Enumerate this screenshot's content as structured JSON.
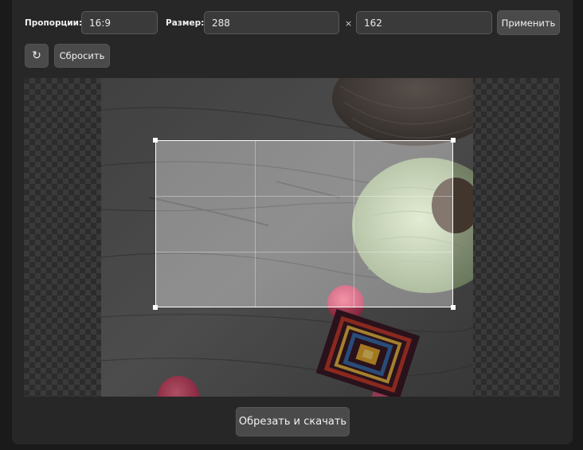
{
  "toolbar": {
    "aspect_label": "Пропорции:",
    "aspect_value": "16:9",
    "size_label": "Размер:",
    "width_value": "288",
    "times": "×",
    "height_value": "162",
    "apply_label": "Применить",
    "rotate_glyph": "↻",
    "reset_label": "Сбросить"
  },
  "footer": {
    "crop_download_label": "Обрезать и скачать"
  },
  "colors": {
    "panel": "#272727",
    "button": "#4a4a4a",
    "crop_frame": "#ffffff"
  },
  "icons": {
    "rotate": "rotate-icon"
  }
}
